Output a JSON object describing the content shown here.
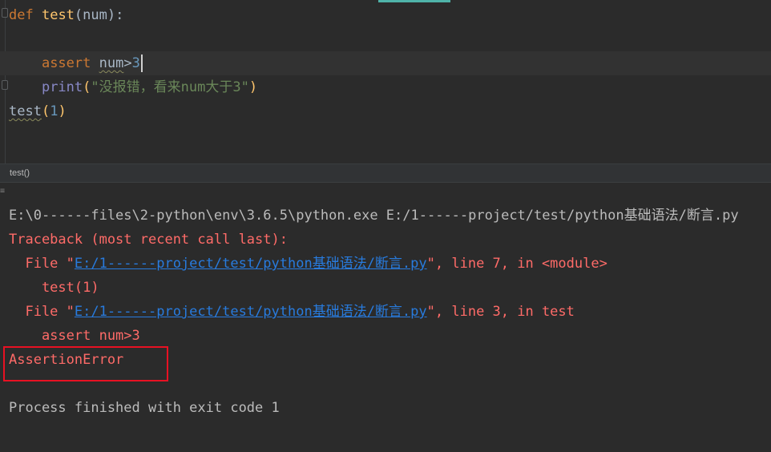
{
  "editor": {
    "lines": [
      {
        "def_kw": "def",
        "fn_name": "test",
        "params": "(num):"
      },
      {
        "assert_kw": "assert",
        "expr": "num",
        "op": ">",
        "value": "3"
      },
      {
        "print_fn": "print",
        "open": "(",
        "string": "\"没报错，看来num大于3\"",
        "close": ")"
      },
      {
        "call_fn": "test",
        "open": "(",
        "arg": "1",
        "close": ")"
      }
    ]
  },
  "breadcrumb": {
    "label": "test()"
  },
  "console": {
    "command": "E:\\0------files\\2-python\\env\\3.6.5\\python.exe E:/1------project/test/python基础语法/断言.py",
    "traceback_header": "Traceback (most recent call last):",
    "frame1_prefix": "  File \"",
    "frame1_link": "E:/1------project/test/python基础语法/断言.py",
    "frame1_suffix": "\", line 7, in <module>",
    "frame1_code": "    test(1)",
    "frame2_prefix": "  File \"",
    "frame2_link": "E:/1------project/test/python基础语法/断言.py",
    "frame2_suffix": "\", line 3, in test",
    "frame2_code": "    assert num>3",
    "error": "AssertionError",
    "exit_message": "Process finished with exit code 1"
  },
  "colors": {
    "editor_bg": "#2b2b2b",
    "keyword": "#cc7832",
    "function": "#ffc66d",
    "string": "#6a8759",
    "number": "#6897bb",
    "error": "#ff6b68",
    "link": "#287bde",
    "highlight_box": "#e81123"
  }
}
